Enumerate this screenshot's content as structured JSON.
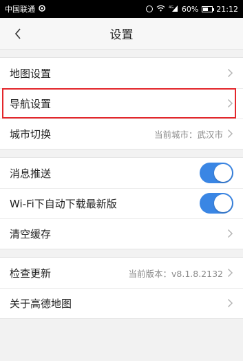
{
  "status_bar": {
    "carrier": "中国联通",
    "battery": "60%",
    "time": "21:12",
    "signal_label": "4G"
  },
  "header": {
    "title": "设置"
  },
  "groups": {
    "g1": [
      {
        "label": "地图设置"
      },
      {
        "label": "导航设置"
      },
      {
        "label": "城市切换",
        "value": "当前城市：武汉市"
      }
    ],
    "g2": [
      {
        "label": "消息推送",
        "toggle": true
      },
      {
        "label": "Wi-Fi下自动下载最新版",
        "toggle": true
      },
      {
        "label": "清空缓存"
      }
    ],
    "g3": [
      {
        "label": "检查更新",
        "value": "当前版本：v8.1.8.2132"
      },
      {
        "label": "关于高德地图"
      }
    ]
  },
  "colors": {
    "accent": "#3a86e4",
    "highlight": "#e3262b"
  }
}
